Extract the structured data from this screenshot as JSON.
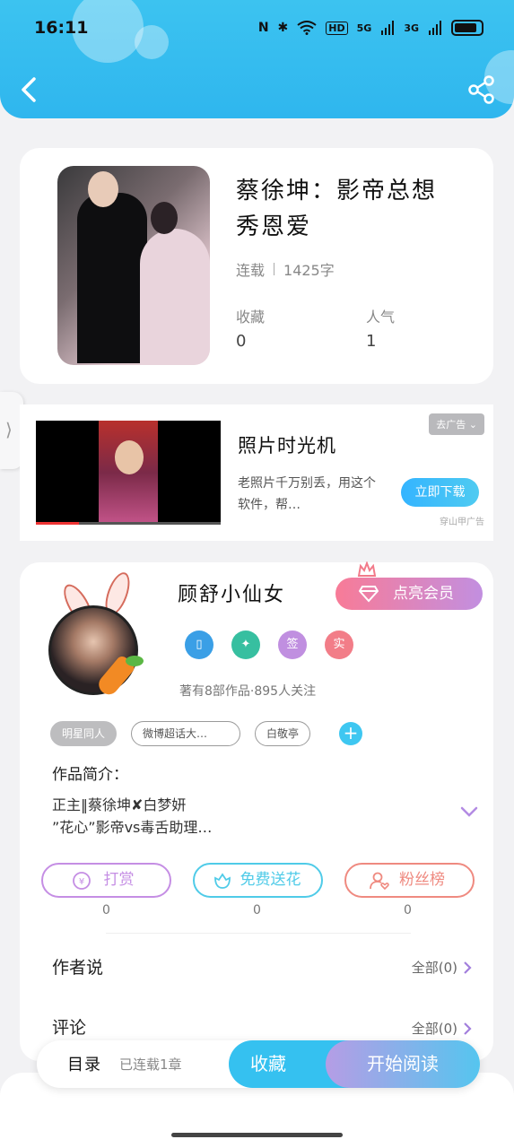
{
  "status_bar": {
    "time": "16:11",
    "icons": [
      "nfc-icon",
      "bluetooth-icon",
      "wifi-icon",
      "hd-icon",
      "signal-5g-icon",
      "signal-3g-icon",
      "battery-icon"
    ],
    "hd_label": "HD",
    "net1": "5G",
    "net2": "3G"
  },
  "header": {
    "back_icon": "back-arrow-icon",
    "share_icon": "share-icon",
    "color": "#35c1f0"
  },
  "book": {
    "title": "蔡徐坤：影帝总想秀恩爱",
    "status": "连载",
    "word_count": "1425字",
    "favorites_label": "收藏",
    "favorites_value": "0",
    "popularity_label": "人气",
    "popularity_value": "1"
  },
  "ad": {
    "title": "照片时光机",
    "description": "老照片千万别丢，用这个软件，帮…",
    "tag": "去广告",
    "button": "立即下载",
    "source": "穿山甲广告"
  },
  "author": {
    "name": "顾舒小仙女",
    "vip_button": "点亮会员",
    "badges": [
      "签",
      "实"
    ],
    "stats": "著有8部作品·895人关注",
    "tags": [
      "明星同人",
      "微博超话大…",
      "白敬亭"
    ],
    "intro_label": "作品简介：",
    "intro_text": "正主‖蔡徐坤✘白梦妍\n”花心”影帝vs毒舌助理…",
    "actions": [
      {
        "label": "打赏",
        "count": "0",
        "color": "#c58ee4"
      },
      {
        "label": "免费送花",
        "count": "0",
        "color": "#4fcbe8"
      },
      {
        "label": "粉丝榜",
        "count": "0",
        "color": "#ef8a80"
      }
    ],
    "author_says_label": "作者说",
    "author_says_right": "全部(0)",
    "comments_label": "评论",
    "comments_right": "全部(0)"
  },
  "bottom_bar": {
    "toc": "目录",
    "chapters": "已连载1章",
    "favorite": "收藏",
    "start_reading": "开始阅读"
  }
}
